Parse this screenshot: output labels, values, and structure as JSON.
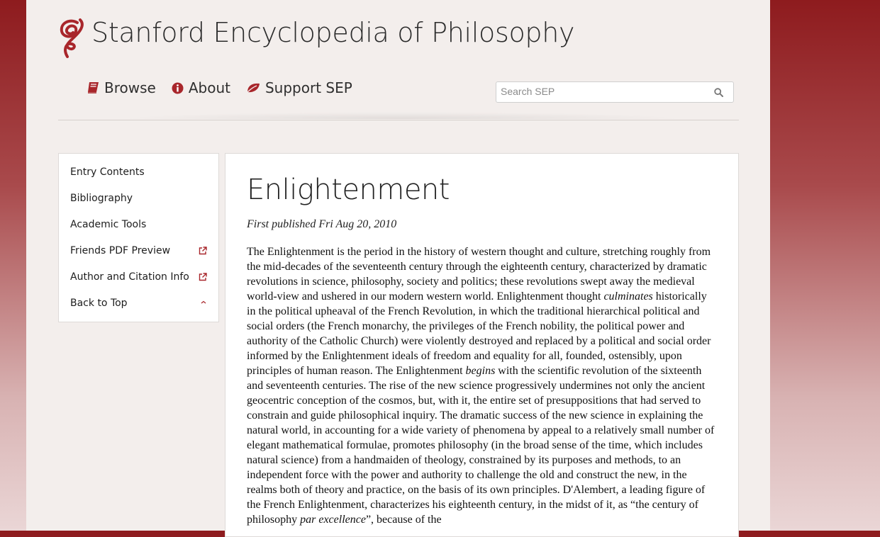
{
  "header": {
    "site_title": "Stanford Encyclopedia of Philosophy",
    "logo_icon": "sep-logo-icon"
  },
  "nav": [
    {
      "label": "Browse",
      "icon": "book-icon"
    },
    {
      "label": "About",
      "icon": "info-circle-icon"
    },
    {
      "label": "Support SEP",
      "icon": "leaf-icon"
    }
  ],
  "search": {
    "placeholder": "Search SEP",
    "icon": "search-icon"
  },
  "toc": {
    "items": [
      {
        "label": "Entry Contents",
        "icon": ""
      },
      {
        "label": "Bibliography",
        "icon": ""
      },
      {
        "label": "Academic Tools",
        "icon": ""
      },
      {
        "label": "Friends PDF Preview",
        "icon": "external-link-icon"
      },
      {
        "label": "Author and Citation Info",
        "icon": "external-link-icon"
      },
      {
        "label": "Back to Top",
        "icon": "chevron-up-icon"
      }
    ]
  },
  "entry": {
    "title": "Enlightenment",
    "pubdate": "First published Fri Aug 20, 2010",
    "preamble": {
      "p1": "The Enlightenment is the period in the history of western thought and culture, stretching roughly from the mid-decades of the seventeenth century through the eighteenth century, characterized by dramatic revolutions in science, philosophy, society and politics; these revolutions swept away the medieval world-view and ushered in our modern western world. Enlightenment thought ",
      "em1": "culminates",
      "p2": " historically in the political upheaval of the French Revolution, in which the traditional hierarchical political and social orders (the French monarchy, the privileges of the French nobility, the political power and authority of the Catholic Church) were violently destroyed and replaced by a political and social order informed by the Enlightenment ideals of freedom and equality for all, founded, ostensibly, upon principles of human reason. The Enlightenment ",
      "em2": "begins",
      "p3": " with the scientific revolution of the sixteenth and seventeenth centuries. The rise of the new science progressively undermines not only the ancient geocentric conception of the cosmos, but, with it, the entire set of presuppositions that had served to constrain and guide philosophical inquiry. The dramatic success of the new science in explaining the natural world, in accounting for a wide variety of phenomena by appeal to a relatively small number of elegant mathematical formulae, promotes philosophy (in the broad sense of the time, which includes natural science) from a handmaiden of theology, constrained by its purposes and methods, to an independent force with the power and authority to challenge the old and construct the new, in the realms both of theory and practice, on the basis of its own principles. D'Alembert, a leading figure of the French Enlightenment, characterizes his eighteenth century, in the midst of it, as “the century of philosophy ",
      "em3": "par excellence",
      "p4": "”, because of the"
    }
  },
  "colors": {
    "accent": "#a8262b",
    "background_top": "#8e1b1e",
    "panel": "#f3eeec"
  }
}
